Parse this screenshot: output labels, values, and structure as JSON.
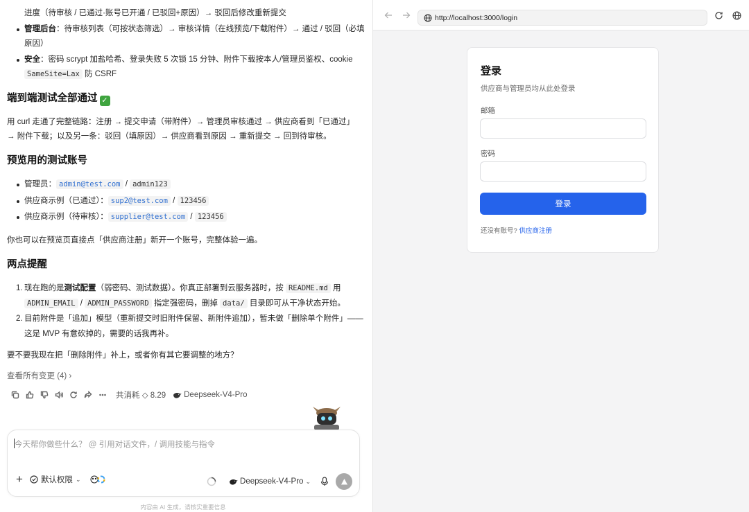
{
  "chat": {
    "top_line": "进度（待审核 / 已通过·账号已开通 / 已驳回+原因）→ 驳回后修改重新提交",
    "bullets_top": [
      {
        "bold": "管理后台",
        "text": "：待审核列表（可按状态筛选）→ 审核详情（在线预览/下载附件）→ 通过 / 驳回（必填原因）"
      },
      {
        "bold": "安全",
        "text": "：密码 scrypt 加盐哈希、登录失败 5 次锁 15 分钟、附件下载按本人/管理员鉴权、cookie",
        "code": "SameSite=Lax",
        "tail": " 防 CSRF"
      }
    ],
    "h_e2e": "端到端测试全部通过",
    "e2e_check": "✓",
    "e2e_text": "用 curl 走通了完整链路：注册 → 提交申请（带附件）→ 管理员审核通过 → 供应商看到「已通过」→ 附件下载；以及另一条：驳回（填原因）→ 供应商看到原因 → 重新提交 → 回到待审核。",
    "h_accounts": "预览用的测试账号",
    "accounts": [
      {
        "label": "管理员：",
        "email": "admin@test.com",
        "sep": " / ",
        "password": "admin123"
      },
      {
        "label": "供应商示例（已通过）：",
        "email": "sup2@test.com",
        "sep": " / ",
        "password": "123456"
      },
      {
        "label": "供应商示例（待审核）：",
        "email": "supplier@test.com",
        "sep": " / ",
        "password": "123456"
      }
    ],
    "accounts_note": "你也可以在预览页直接点「供应商注册」新开一个账号，完整体验一遍。",
    "h_tips": "两点提醒",
    "tips": [
      {
        "num": "1.",
        "pre": "现在跑的是",
        "bold": "测试配置",
        "mid": "（弱密码、测试数据）。你真正部署到云服务器时，按 ",
        "code1": "README.md",
        "mid2": " 用",
        "code2": "ADMIN_EMAIL",
        "sep": " / ",
        "code3": "ADMIN_PASSWORD",
        "mid3": " 指定强密码，删掉 ",
        "code4": "data/",
        "end": " 目录即可从干净状态开始。"
      },
      {
        "num": "2.",
        "text": "目前附件是「追加」模型（重新提交时旧附件保留、新附件追加），暂未做「删除单个附件」——这是 MVP 有意砍掉的，需要的话我再补。"
      }
    ],
    "question": "要不要我现在把「删除附件」补上，或者你有其它要调整的地方？",
    "changes_link": "查看所有变更 (4) ›",
    "cost_text": "共消耗 ◇ 8.29",
    "model_name": "Deepseek-V4-Pro"
  },
  "composer": {
    "placeholder": "今天帮你做些什么？ @ 引用对话文件，/ 调用技能与指令",
    "permission": "默认权限",
    "model": "Deepseek-V4-Pro",
    "footnote": "内容由 AI 生成，请核实重要信息"
  },
  "browser": {
    "url": "http://localhost:3000/login",
    "login": {
      "title": "登录",
      "subtitle": "供应商与管理员均从此处登录",
      "email_label": "邮箱",
      "password_label": "密码",
      "submit": "登录",
      "register_prompt": "还没有账号?",
      "register_link": "供应商注册"
    }
  },
  "colors": {
    "primary": "#2563eb",
    "check": "#3fa43f",
    "link_code": "#2f6fd0"
  }
}
